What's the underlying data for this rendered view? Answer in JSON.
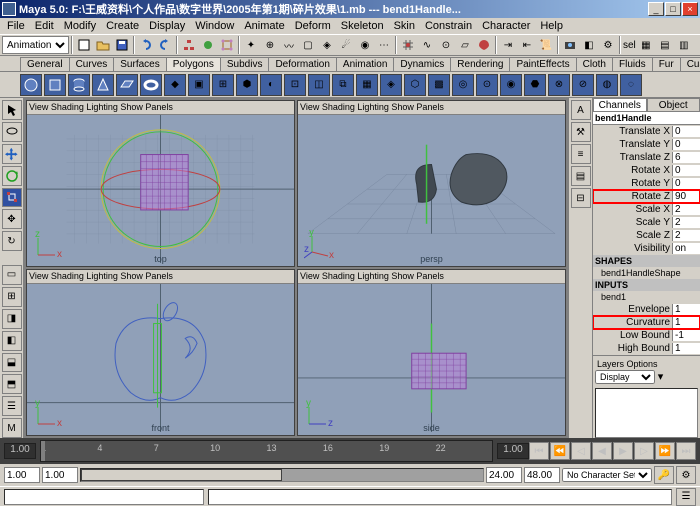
{
  "title": "Maya 5.0: F:\\王威资料\\个人作品\\数字世界\\2005年第1期\\碎片效果\\1.mb --- bend1Handle...",
  "menus": [
    "File",
    "Edit",
    "Modify",
    "Create",
    "Display",
    "Window",
    "Animate",
    "Deform",
    "Skeleton",
    "Skin",
    "Constrain",
    "Character",
    "Help"
  ],
  "mode": "Animation",
  "sel_label": "sel",
  "shelf_tabs": [
    "General",
    "Curves",
    "Surfaces",
    "Polygons",
    "Subdivs",
    "Deformation",
    "Animation",
    "Dynamics",
    "Rendering",
    "PaintEffects",
    "Cloth",
    "Fluids",
    "Fur",
    "Custom"
  ],
  "shelf_active": "Polygons",
  "vp_menu": "View Shading Lighting Show Panels",
  "vp_labels": {
    "top": "top",
    "persp": "persp",
    "front": "front",
    "side": "side"
  },
  "cb": {
    "tabs": [
      "Channels",
      "Object"
    ],
    "node": "bend1Handle",
    "attrs": [
      {
        "name": "Translate X",
        "val": "0"
      },
      {
        "name": "Translate Y",
        "val": "0"
      },
      {
        "name": "Translate Z",
        "val": "6"
      },
      {
        "name": "Rotate X",
        "val": "0"
      },
      {
        "name": "Rotate Y",
        "val": "0"
      },
      {
        "name": "Rotate Z",
        "val": "90",
        "hl": true
      },
      {
        "name": "Scale X",
        "val": "2"
      },
      {
        "name": "Scale Y",
        "val": "2"
      },
      {
        "name": "Scale Z",
        "val": "2"
      },
      {
        "name": "Visibility",
        "val": "on"
      }
    ],
    "shapes_label": "SHAPES",
    "shape_node": "bend1HandleShape",
    "inputs_label": "INPUTS",
    "input_node": "bend1",
    "input_attrs": [
      {
        "name": "Envelope",
        "val": "1"
      },
      {
        "name": "Curvature",
        "val": "1",
        "hl": true
      },
      {
        "name": "Low Bound",
        "val": "-1"
      },
      {
        "name": "High Bound",
        "val": "1"
      }
    ],
    "layers_menu": "Layers Options",
    "display_label": "Display"
  },
  "timeline": {
    "ticks": [
      "1",
      "4",
      "7",
      "10",
      "13",
      "16",
      "19",
      "22"
    ],
    "current": "1.00",
    "start": "1.00",
    "in": "1.00",
    "out": "24.00",
    "end": "48.00",
    "char_label": "No Character Set"
  }
}
